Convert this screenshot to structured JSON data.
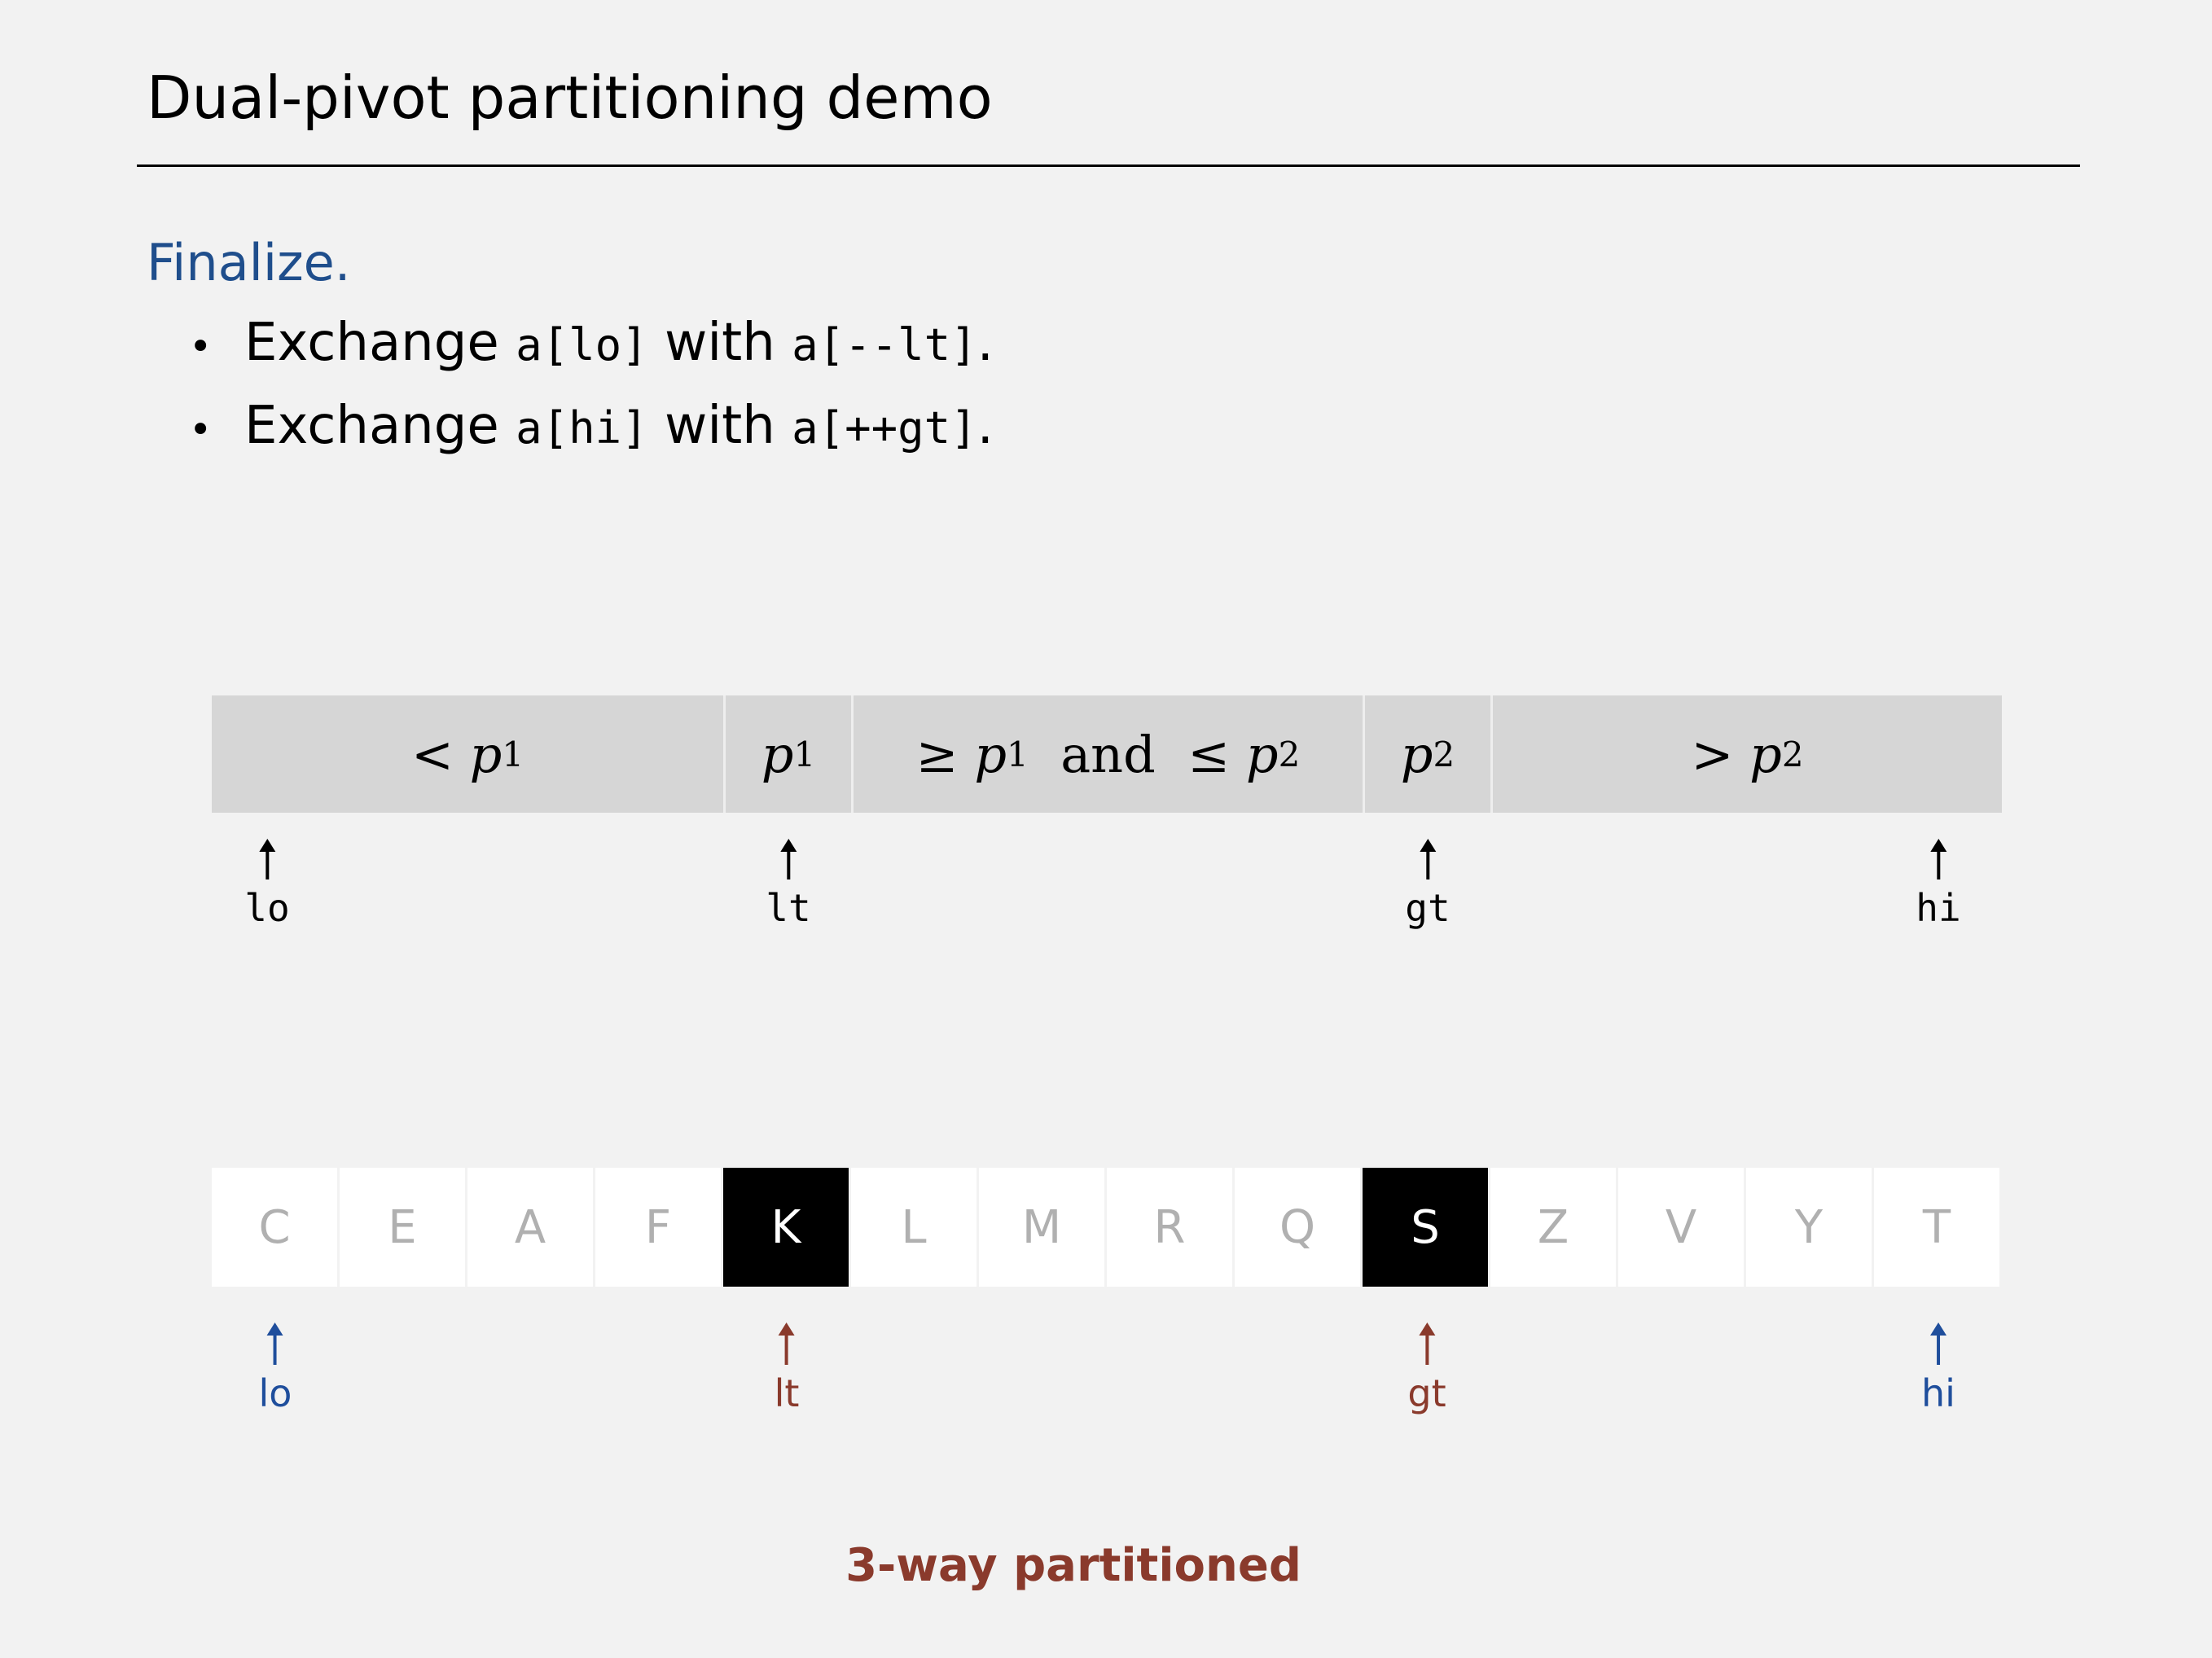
{
  "title": "Dual-pivot partitioning demo",
  "subtitle": "Finalize.",
  "bullets": [
    {
      "dot": "•",
      "prefix": "Exchange ",
      "code1": "a[lo]",
      "mid": " with ",
      "code2": "a[--lt]",
      "suffix": "."
    },
    {
      "dot": "•",
      "prefix": "Exchange ",
      "code1": "a[hi]",
      "mid": " with ",
      "code2": "a[++gt]",
      "suffix": "."
    }
  ],
  "regions": [
    {
      "op1": "< ",
      "v1": "p",
      "s1": "1",
      "mid": "",
      "op2": "",
      "v2": "",
      "s2": ""
    },
    {
      "op1": "",
      "v1": "p",
      "s1": "1",
      "mid": "",
      "op2": "",
      "v2": "",
      "s2": ""
    },
    {
      "op1": "≥ ",
      "v1": "p",
      "s1": "1",
      "mid": "  and  ",
      "op2": "≤ ",
      "v2": "p",
      "s2": "2"
    },
    {
      "op1": "",
      "v1": "p",
      "s1": "2",
      "mid": "",
      "op2": "",
      "v2": "",
      "s2": ""
    },
    {
      "op1": "> ",
      "v1": "p",
      "s1": "2",
      "mid": "",
      "op2": "",
      "v2": "",
      "s2": ""
    }
  ],
  "top_pointers": [
    "lo",
    "lt",
    "gt",
    "hi"
  ],
  "array": [
    "C",
    "E",
    "A",
    "F",
    "K",
    "L",
    "M",
    "R",
    "Q",
    "S",
    "Z",
    "V",
    "Y",
    "T"
  ],
  "highlighted": [
    "K",
    "S"
  ],
  "bottom_pointers": [
    {
      "label": "lo",
      "color": "#1f4e9c"
    },
    {
      "label": "lt",
      "color": "#8a3a2c"
    },
    {
      "label": "gt",
      "color": "#8a3a2c"
    },
    {
      "label": "hi",
      "color": "#1f4e9c"
    }
  ],
  "caption": "3-way partitioned"
}
